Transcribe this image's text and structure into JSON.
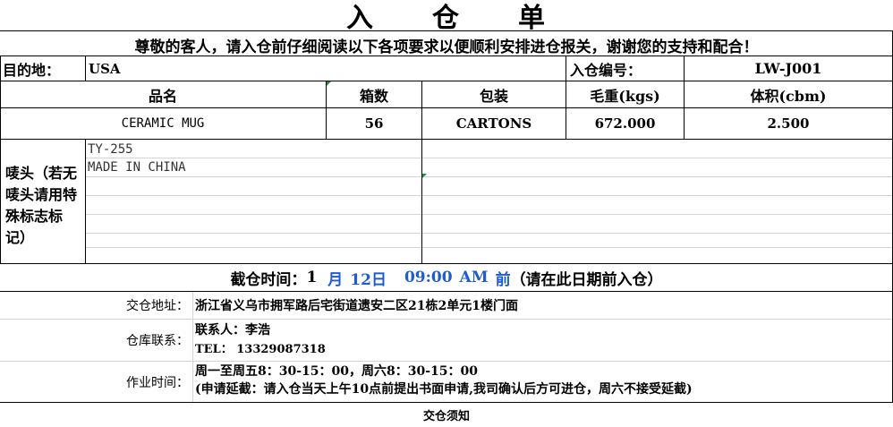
{
  "title": "入　　仓　　单",
  "notice": "尊敬的客人，请入仓前仔细阅读以下各项要求以便顺利安排进仓报关，谢谢您的支持和配合！",
  "destination": {
    "label": "目的地：",
    "value": "USA"
  },
  "entry_no": {
    "label": "入仓编号：",
    "value": "LW-J001"
  },
  "headers": {
    "product_name": "品名",
    "cartons": "箱数",
    "packing": "包装",
    "gross_weight": "毛重(kgs)",
    "volume": "体积(cbm)"
  },
  "row": {
    "product_name": "CERAMIC MUG",
    "cartons": "56",
    "packing": "CARTONS",
    "gross_weight": "672.000",
    "volume": "2.500"
  },
  "marks": {
    "label": "唛头（若无唛头请用特殊标志标记）",
    "line1": "TY-255",
    "line2": "MADE IN CHINA"
  },
  "cutoff": {
    "prefix": "截仓时间：",
    "day_num": "1",
    "month": "月",
    "date": "12日",
    "time": "09:00",
    "ampm": "AM",
    "before": "前",
    "note": "（请在此日期前入仓）"
  },
  "address": {
    "label": "交仓地址：",
    "value": "浙江省义乌市拥军路后宅街道遗安二区21栋2单元1楼门面"
  },
  "contact": {
    "label": "仓库联系：",
    "person": "联系人：李浩",
    "tel": "TEL： 13329087318"
  },
  "hours": {
    "label": "作业时间：",
    "line1": "周一至周五8：30-15：00，周六8：30-15：00",
    "line2": "(申请延截：请入仓当天上午10点前提出书面申请,我司确认后方可进仓，周六不接受延截)"
  },
  "footer": "交仓须知"
}
